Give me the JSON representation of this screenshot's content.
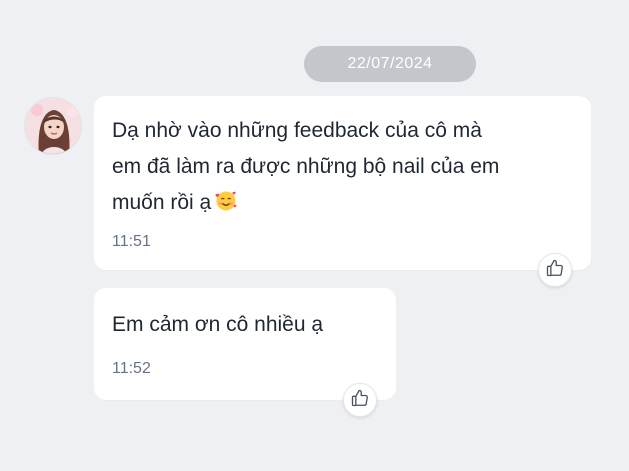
{
  "date_separator": "22/07/2024",
  "messages": [
    {
      "text": "Dạ nhờ vào những feedback của cô mà\nem đã làm ra được những bộ nail của em\nmuốn rồi ạ",
      "emoji": "smiling-face-with-hearts",
      "time": "11:51"
    },
    {
      "text": "Em cảm ơn cô nhiều ạ",
      "time": "11:52"
    }
  ],
  "icons": {
    "reaction": "thumbs-up-icon",
    "emoji": "smiling-face-with-hearts-emoji"
  },
  "colors": {
    "background": "#eef0f3",
    "bubble": "#ffffff",
    "date_pill": "#c4c6cb",
    "text": "#1f2733",
    "time": "#66728a"
  }
}
